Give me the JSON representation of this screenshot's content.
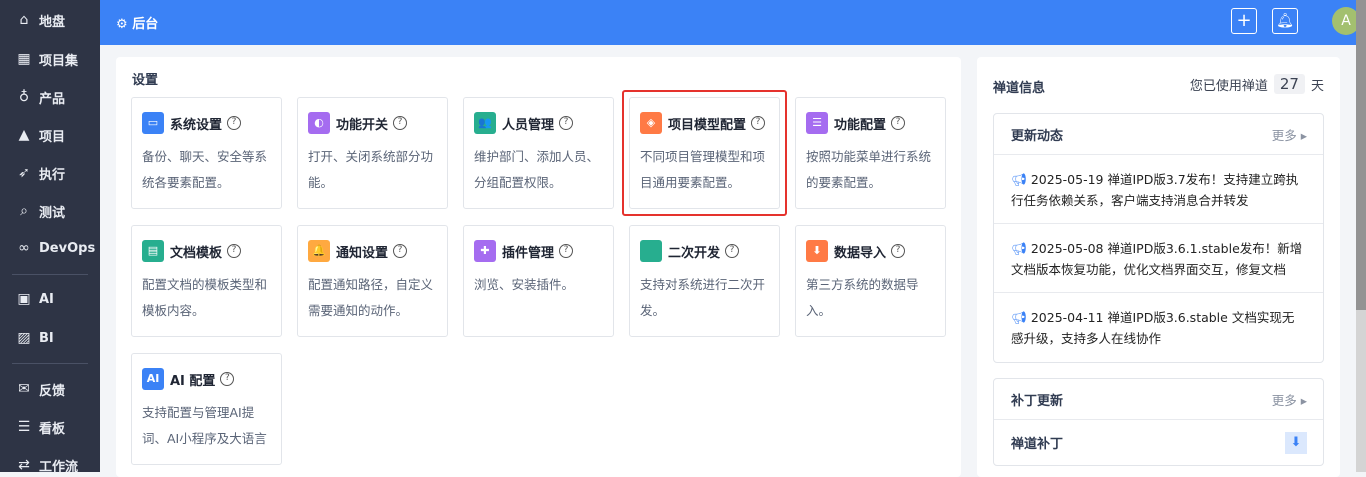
{
  "sidebar": {
    "items": [
      {
        "label": "地盘",
        "icon": "home-icon"
      },
      {
        "label": "项目集",
        "icon": "grid-icon"
      },
      {
        "label": "产品",
        "icon": "bulb-icon"
      },
      {
        "label": "项目",
        "icon": "rocket-icon"
      },
      {
        "label": "执行",
        "icon": "run-icon"
      },
      {
        "label": "测试",
        "icon": "search-icon"
      },
      {
        "label": "DevOps",
        "icon": "infinity-icon"
      },
      {
        "label": "AI",
        "icon": "robot-icon"
      },
      {
        "label": "BI",
        "icon": "chart-board-icon"
      },
      {
        "label": "反馈",
        "icon": "feedback-icon"
      },
      {
        "label": "看板",
        "icon": "kanban-icon"
      },
      {
        "label": "工作流",
        "icon": "workflow-icon"
      }
    ]
  },
  "header": {
    "title": "后台",
    "add": "+",
    "avatar": "A"
  },
  "main": {
    "title": "设置",
    "cards": [
      {
        "title": "系统设置",
        "desc": "备份、聊天、安全等系统各要素配置。",
        "color": "#3b82f6",
        "glyph": "▭"
      },
      {
        "title": "功能开关",
        "desc": "打开、关闭系统部分功能。",
        "color": "#a56cf0",
        "glyph": "◐"
      },
      {
        "title": "人员管理",
        "desc": "维护部门、添加人员、分组配置权限。",
        "color": "#27ae8f",
        "glyph": "👥"
      },
      {
        "title": "项目模型配置",
        "desc": "不同项目管理模型和项目通用要素配置。",
        "color": "#ff7a45",
        "glyph": "◈"
      },
      {
        "title": "功能配置",
        "desc": "按照功能菜单进行系统的要素配置。",
        "color": "#a56cf0",
        "glyph": "☰"
      },
      {
        "title": "文档模板",
        "desc": "配置文档的模板类型和模板内容。",
        "color": "#27ae8f",
        "glyph": "▤"
      },
      {
        "title": "通知设置",
        "desc": "配置通知路径，自定义需要通知的动作。",
        "color": "#ffa940",
        "glyph": "🔔"
      },
      {
        "title": "插件管理",
        "desc": "浏览、安装插件。",
        "color": "#a56cf0",
        "glyph": "✚"
      },
      {
        "title": "二次开发",
        "desc": "支持对系统进行二次开发。",
        "color": "#27ae8f",
        "glyph": "</>"
      },
      {
        "title": "数据导入",
        "desc": "第三方系统的数据导入。",
        "color": "#ff7a45",
        "glyph": "⬇"
      },
      {
        "title": "AI 配置",
        "desc": "支持配置与管理AI提词、AI小程序及大语言",
        "color": "#3b82f6",
        "glyph": "AI"
      }
    ]
  },
  "right": {
    "title": "禅道信息",
    "days_prefix": "您已使用禅道",
    "days": "27",
    "days_suffix": "天",
    "updates": {
      "title": "更新动态",
      "more": "更多",
      "items": [
        "2025-05-19 禅道IPD版3.7发布！支持建立跨执行任务依赖关系，客户端支持消息合并转发",
        "2025-05-08 禅道IPD版3.6.1.stable发布！新增文档版本恢复功能，优化文档界面交互，修复文档",
        "2025-04-11 禅道IPD版3.6.stable 文档实现无感升级，支持多人在线协作"
      ]
    },
    "patches": {
      "title": "补丁更新",
      "more": "更多",
      "item": "禅道补丁"
    }
  }
}
